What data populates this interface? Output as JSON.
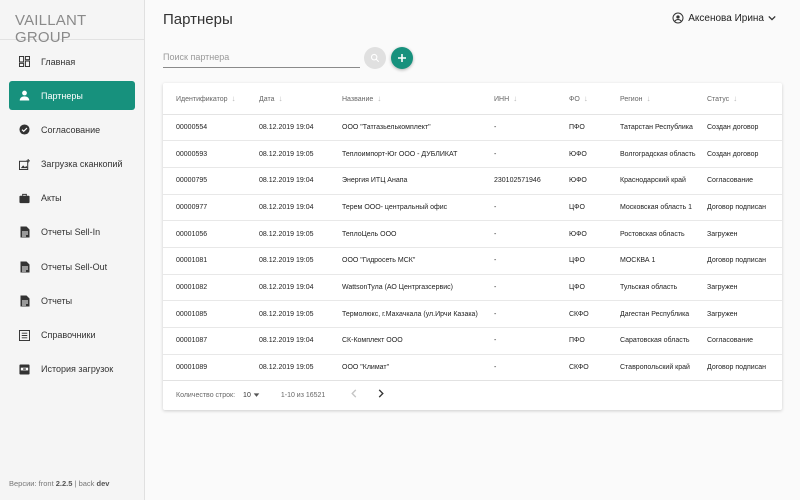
{
  "logo": "VAILLANT GROUP",
  "nav": [
    {
      "label": "Главная",
      "icon": "dashboard-icon",
      "active": false
    },
    {
      "label": "Партнеры",
      "icon": "person-icon",
      "active": true
    },
    {
      "label": "Согласование",
      "icon": "check-circle-icon",
      "active": false
    },
    {
      "label": "Загрузка сканкопий",
      "icon": "add-photo-icon",
      "active": false
    },
    {
      "label": "Акты",
      "icon": "briefcase-icon",
      "active": false
    },
    {
      "label": "Отчеты Sell-In",
      "icon": "document-icon",
      "active": false
    },
    {
      "label": "Отчеты Sell-Out",
      "icon": "document-icon",
      "active": false
    },
    {
      "label": "Отчеты",
      "icon": "document-icon",
      "active": false
    },
    {
      "label": "Справочники",
      "icon": "list-icon",
      "active": false
    },
    {
      "label": "История загрузок",
      "icon": "archive-icon",
      "active": false
    }
  ],
  "version": {
    "prefix": "Версии: front",
    "front": "2.2.5",
    "separator": "| back",
    "back": "dev"
  },
  "page_title": "Партнеры",
  "user": {
    "name": "Аксенова Ирина",
    "icon": "account-circle-icon"
  },
  "search": {
    "placeholder": "Поиск партнера"
  },
  "table": {
    "columns": [
      "Идентификатор",
      "Дата",
      "Название",
      "ИНН",
      "ФО",
      "Регион",
      "Статус"
    ],
    "rows": [
      {
        "id": "00000554",
        "date": "08.12.2019 19:04",
        "name": "ООО \"Татгазьелькомплект\"",
        "inn": "-",
        "fo": "ПФО",
        "region": "Татарстан Республика",
        "status": "Создан договор"
      },
      {
        "id": "00000593",
        "date": "08.12.2019 19:05",
        "name": "Теплоимпорт-Юг ООО - ДУБЛИКАТ",
        "inn": "-",
        "fo": "ЮФО",
        "region": "Волгоградская область",
        "status": "Создан договор"
      },
      {
        "id": "00000795",
        "date": "08.12.2019 19:04",
        "name": "Энергия ИТЦ Анапа",
        "inn": "230102571946",
        "fo": "ЮФО",
        "region": "Краснодарский край",
        "status": "Согласование"
      },
      {
        "id": "00000977",
        "date": "08.12.2019 19:04",
        "name": "Терем ООО- центральный офис",
        "inn": "-",
        "fo": "ЦФО",
        "region": "Московская область 1",
        "status": "Договор подписан"
      },
      {
        "id": "00001056",
        "date": "08.12.2019 19:05",
        "name": "ТеплоЦель ООО",
        "inn": "-",
        "fo": "ЮФО",
        "region": "Ростовская область",
        "status": "Загружен"
      },
      {
        "id": "00001081",
        "date": "08.12.2019 19:05",
        "name": "ООО \"Гидросеть МСК\"",
        "inn": "-",
        "fo": "ЦФО",
        "region": "МОСКВА 1",
        "status": "Договор подписан"
      },
      {
        "id": "00001082",
        "date": "08.12.2019 19:04",
        "name": "WattsonТула (АО Центргазсервис)",
        "inn": "-",
        "fo": "ЦФО",
        "region": "Тульская область",
        "status": "Загружен"
      },
      {
        "id": "00001085",
        "date": "08.12.2019 19:05",
        "name": "Термолюкс, г.Махачкала (ул.Ирчи Казака)",
        "inn": "-",
        "fo": "СКФО",
        "region": "Дагестан Республика",
        "status": "Загружен"
      },
      {
        "id": "00001087",
        "date": "08.12.2019 19:04",
        "name": "СК-Комплект ООО",
        "inn": "-",
        "fo": "ПФО",
        "region": "Саратовская область",
        "status": "Согласование"
      },
      {
        "id": "00001089",
        "date": "08.12.2019 19:05",
        "name": "ООО \"Климат\"",
        "inn": "-",
        "fo": "СКФО",
        "region": "Ставропольский край",
        "status": "Договор подписан"
      }
    ]
  },
  "pagination": {
    "rows_label": "Количество строк:",
    "rows_per_page": "10",
    "range": "1-10 из 16521"
  },
  "colors": {
    "accent": "#17917d"
  }
}
